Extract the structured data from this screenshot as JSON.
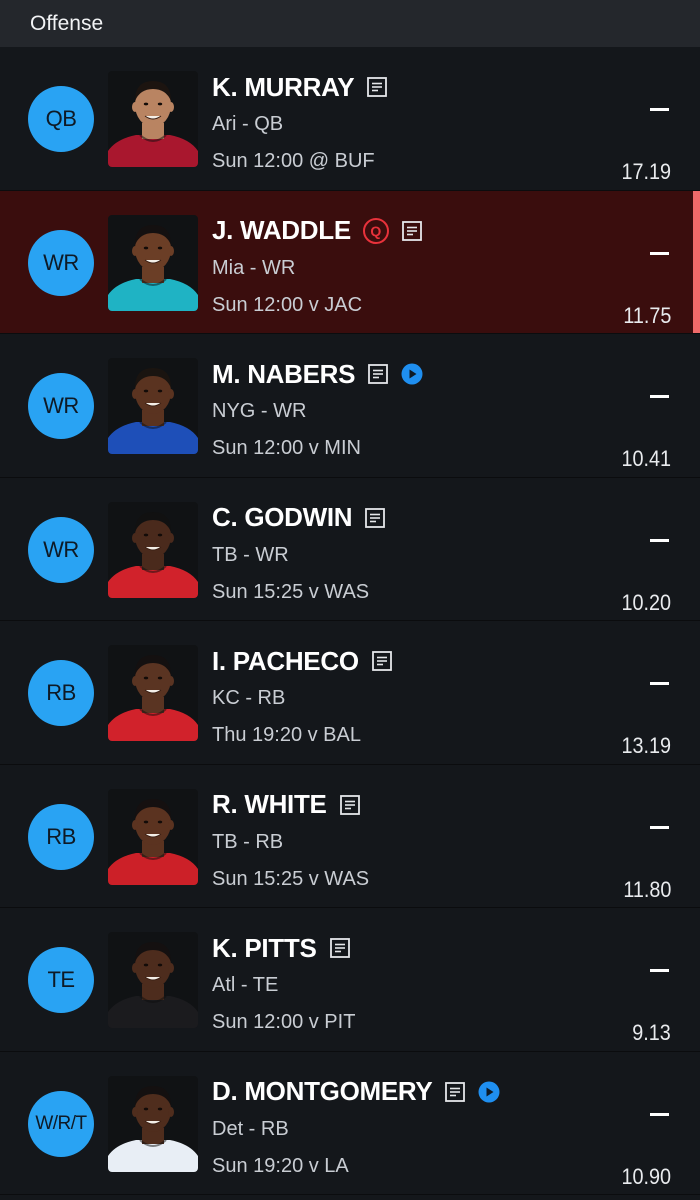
{
  "section": {
    "title": "Offense"
  },
  "players": [
    {
      "pos": "QB",
      "name": "K. MURRAY",
      "team_pos": "Ari - QB",
      "game": "Sun 12:00 @ BUF",
      "proj": "17.19",
      "status": "",
      "has_video": false,
      "alert": false,
      "jersey": "#a9172e",
      "skin": "#b98462",
      "hair": "#1c1410"
    },
    {
      "pos": "WR",
      "name": "J. WADDLE",
      "team_pos": "Mia - WR",
      "game": "Sun 12:00 v JAC",
      "proj": "11.75",
      "status": "Q",
      "has_video": false,
      "alert": true,
      "jersey": "#1fb3c4",
      "skin": "#6b3e26",
      "hair": "#141010"
    },
    {
      "pos": "WR",
      "name": "M. NABERS",
      "team_pos": "NYG - WR",
      "game": "Sun 12:00 v MIN",
      "proj": "10.41",
      "status": "",
      "has_video": true,
      "alert": false,
      "jersey": "#1e4fb8",
      "skin": "#5a3320",
      "hair": "#1a1410"
    },
    {
      "pos": "WR",
      "name": "C. GODWIN",
      "team_pos": "TB - WR",
      "game": "Sun 15:25 v WAS",
      "proj": "10.20",
      "status": "",
      "has_video": false,
      "alert": false,
      "jersey": "#d1222b",
      "skin": "#4a2a1c",
      "hair": "#111111"
    },
    {
      "pos": "RB",
      "name": "I. PACHECO",
      "team_pos": "KC - RB",
      "game": "Thu 19:20 v BAL",
      "proj": "13.19",
      "status": "",
      "has_video": false,
      "alert": false,
      "jersey": "#d1222b",
      "skin": "#5a3422",
      "hair": "#141010"
    },
    {
      "pos": "RB",
      "name": "R. WHITE",
      "team_pos": "TB - RB",
      "game": "Sun 15:25 v WAS",
      "proj": "11.80",
      "status": "",
      "has_video": false,
      "alert": false,
      "jersey": "#cc2028",
      "skin": "#5b3320",
      "hair": "#151010"
    },
    {
      "pos": "TE",
      "name": "K. PITTS",
      "team_pos": "Atl - TE",
      "game": "Sun 12:00 v PIT",
      "proj": "9.13",
      "status": "",
      "has_video": false,
      "alert": false,
      "jersey": "#1b1b1e",
      "skin": "#4d2c1d",
      "hair": "#141010"
    },
    {
      "pos": "W/R/T",
      "name": "D. MONTGOMERY",
      "team_pos": "Det - RB",
      "game": "Sun 19:20 v LA",
      "proj": "10.90",
      "status": "",
      "has_video": true,
      "alert": false,
      "jersey": "#e8eef5",
      "skin": "#4f2d1d",
      "hair": "#141010"
    }
  ],
  "colors": {
    "badge": "#29a3f3",
    "alert_bg": "#3a0d0d",
    "alert_bar": "#f06a6a",
    "video": "#1f8ff0"
  },
  "icons": {
    "notes": "notes-icon",
    "video": "play-video-icon",
    "questionable": "questionable-badge"
  }
}
